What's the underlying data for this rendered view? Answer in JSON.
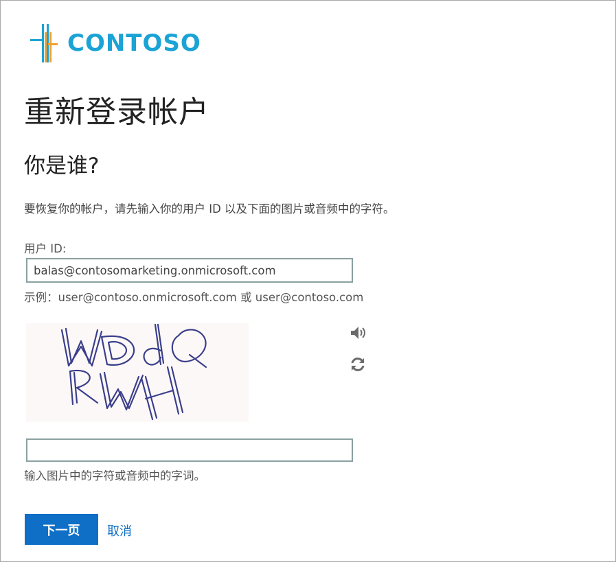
{
  "logo": {
    "text": "CONTOSO",
    "icon": "contoso-logo-icon"
  },
  "page": {
    "title": "重新登录帐户",
    "subtitle": "你是谁?",
    "description": "要恢复你的帐户，请先输入你的用户 ID 以及下面的图片或音频中的字符。"
  },
  "user_id": {
    "label": "用户 ID:",
    "value": "balas@contosomarketing.onmicrosoft.com",
    "example": "示例：user@contoso.onmicrosoft.com 或 user@contoso.com"
  },
  "captcha": {
    "image_text": "WDdQ RWH",
    "audio_icon": "speaker-icon",
    "refresh_icon": "refresh-icon",
    "input_value": "",
    "hint": "输入图片中的字符或音频中的字词。"
  },
  "actions": {
    "next_label": "下一页",
    "cancel_label": "取消"
  },
  "colors": {
    "brand": "#1ba3d6",
    "logo_orange": "#f0a030",
    "primary_button": "#0f6fc6",
    "input_border": "#8aa1a1"
  }
}
